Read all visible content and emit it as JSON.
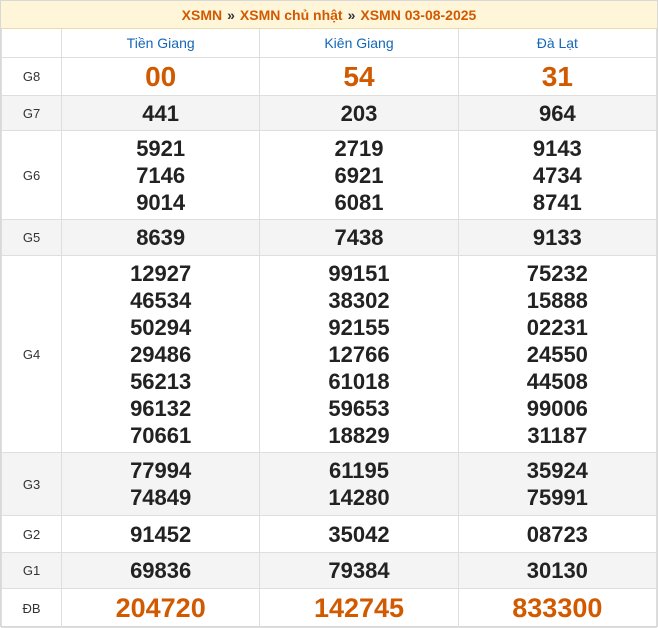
{
  "breadcrumb": {
    "items": [
      "XSMN",
      "XSMN chủ nhật",
      "XSMN 03-08-2025"
    ],
    "separator": "»"
  },
  "provinces": [
    "Tiền Giang",
    "Kiên Giang",
    "Đà Lạt"
  ],
  "prizes": [
    {
      "label": "G8",
      "values": [
        [
          "00"
        ],
        [
          "54"
        ],
        [
          "31"
        ]
      ]
    },
    {
      "label": "G7",
      "values": [
        [
          "441"
        ],
        [
          "203"
        ],
        [
          "964"
        ]
      ]
    },
    {
      "label": "G6",
      "values": [
        [
          "5921",
          "7146",
          "9014"
        ],
        [
          "2719",
          "6921",
          "6081"
        ],
        [
          "9143",
          "4734",
          "8741"
        ]
      ]
    },
    {
      "label": "G5",
      "values": [
        [
          "8639"
        ],
        [
          "7438"
        ],
        [
          "9133"
        ]
      ]
    },
    {
      "label": "G4",
      "values": [
        [
          "12927",
          "46534",
          "50294",
          "29486",
          "56213",
          "96132",
          "70661"
        ],
        [
          "99151",
          "38302",
          "92155",
          "12766",
          "61018",
          "59653",
          "18829"
        ],
        [
          "75232",
          "15888",
          "02231",
          "24550",
          "44508",
          "99006",
          "31187"
        ]
      ]
    },
    {
      "label": "G3",
      "values": [
        [
          "77994",
          "74849"
        ],
        [
          "61195",
          "14280"
        ],
        [
          "35924",
          "75991"
        ]
      ]
    },
    {
      "label": "G2",
      "values": [
        [
          "91452"
        ],
        [
          "35042"
        ],
        [
          "08723"
        ]
      ]
    },
    {
      "label": "G1",
      "values": [
        [
          "69836"
        ],
        [
          "79384"
        ],
        [
          "30130"
        ]
      ]
    },
    {
      "label": "ĐB",
      "values": [
        [
          "204720"
        ],
        [
          "142745"
        ],
        [
          "833300"
        ]
      ]
    }
  ],
  "colors": {
    "accent": "#d15a00",
    "header_text": "#1367b8",
    "title_bg": "#fff6d9"
  }
}
